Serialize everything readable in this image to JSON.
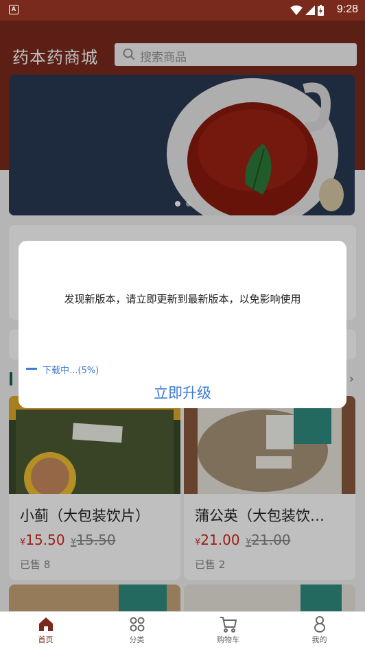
{
  "status_bar": {
    "time": "9:28"
  },
  "header": {
    "title": "药本药商城"
  },
  "search": {
    "placeholder": "搜索商品"
  },
  "banner": {
    "dots_total": 2,
    "active_dot": 1
  },
  "products": [
    {
      "name": "小蓟（大包装饮片）",
      "currency": "¥",
      "price": "15.50",
      "original_price": "15.50",
      "sold": "已售 8"
    },
    {
      "name": "蒲公英（大包装饮…",
      "currency": "¥",
      "price": "21.00",
      "original_price": "21.00",
      "sold": "已售 2"
    }
  ],
  "dialog": {
    "message": "发现新版本，请立即更新到最新版本，以免影响使用",
    "progress_text": "下载中...(5%)",
    "progress": 0.05,
    "upgrade_label": "立即升级"
  },
  "tabbar": {
    "tabs": [
      {
        "label": "首页",
        "icon": "home-icon",
        "active": true
      },
      {
        "label": "分类",
        "icon": "grid-icon",
        "active": false
      },
      {
        "label": "购物车",
        "icon": "cart-icon",
        "active": false
      },
      {
        "label": "我的",
        "icon": "person-icon",
        "active": false
      }
    ]
  },
  "colors": {
    "brand": "#7a2a1c",
    "price": "#d0271c",
    "link": "#3e7bd6"
  }
}
